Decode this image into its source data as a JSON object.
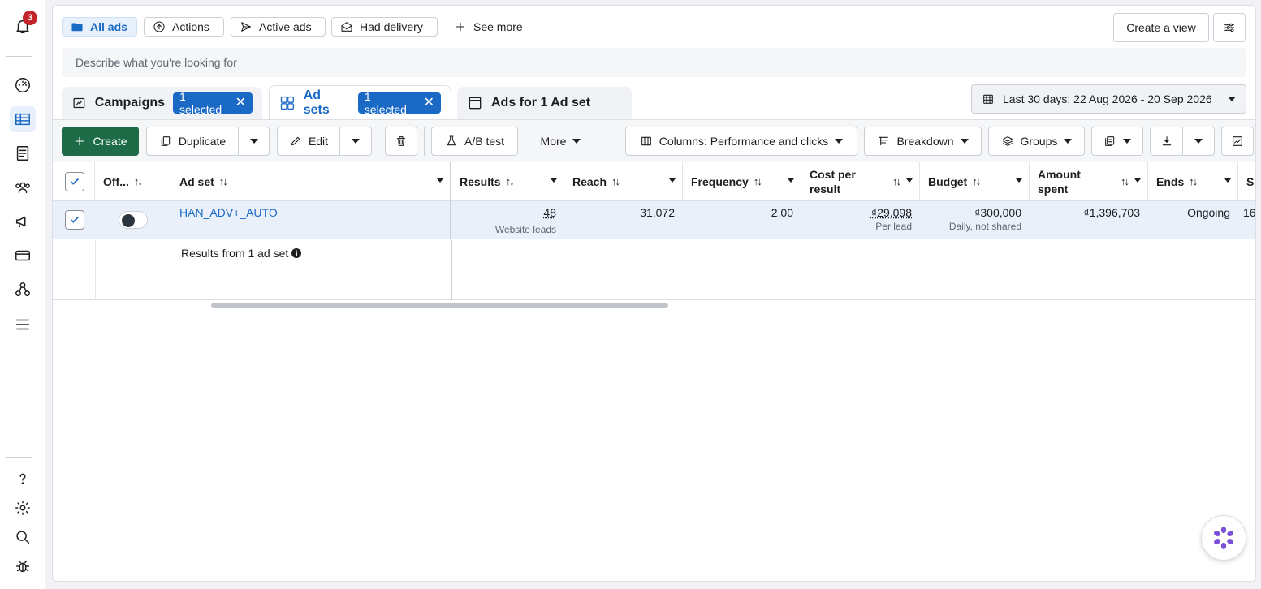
{
  "notifications": {
    "count": "3"
  },
  "filters": {
    "all_ads": "All ads",
    "actions": "Actions",
    "active_ads": "Active ads",
    "had_delivery": "Had delivery",
    "see_more": "See more"
  },
  "view": {
    "create_view": "Create a view"
  },
  "search": {
    "placeholder": "Describe what you're looking for"
  },
  "levels": {
    "campaigns": {
      "label": "Campaigns",
      "selected": "1 selected"
    },
    "ad_sets": {
      "label": "Ad sets",
      "selected": "1 selected"
    },
    "ads": {
      "label": "Ads for 1 Ad set"
    }
  },
  "date_range": "Last 30 days: 22 Aug 2026 - 20 Sep 2026",
  "toolbar": {
    "create": "Create",
    "duplicate": "Duplicate",
    "edit": "Edit",
    "ab_test": "A/B test",
    "more": "More",
    "columns": "Columns: Performance and clicks",
    "breakdown": "Breakdown",
    "groups": "Groups"
  },
  "table": {
    "headers": {
      "off": "Off...",
      "ad_set": "Ad set",
      "results": "Results",
      "reach": "Reach",
      "frequency": "Frequency",
      "cost_per_result": "Cost per result",
      "budget": "Budget",
      "amount_spent": "Amount spent",
      "ends": "Ends",
      "next": "Sc"
    },
    "row": {
      "ad_set": "HAN_ADV+_AUTO",
      "results": "48",
      "results_sub": "Website leads",
      "reach": "31,072",
      "frequency": "2.00",
      "cost_per_result": "₫29,098",
      "cost_sub": "Per lead",
      "budget": "₫300,000",
      "budget_sub": "Daily, not shared",
      "amount_spent": "₫1,396,703",
      "ends": "Ongoing",
      "next": "16"
    },
    "summary": "Results from 1 ad set"
  },
  "colors": {
    "accent": "#1a6ac5",
    "create_green": "#1d6b47",
    "row_selected": "#e9f0fa"
  }
}
